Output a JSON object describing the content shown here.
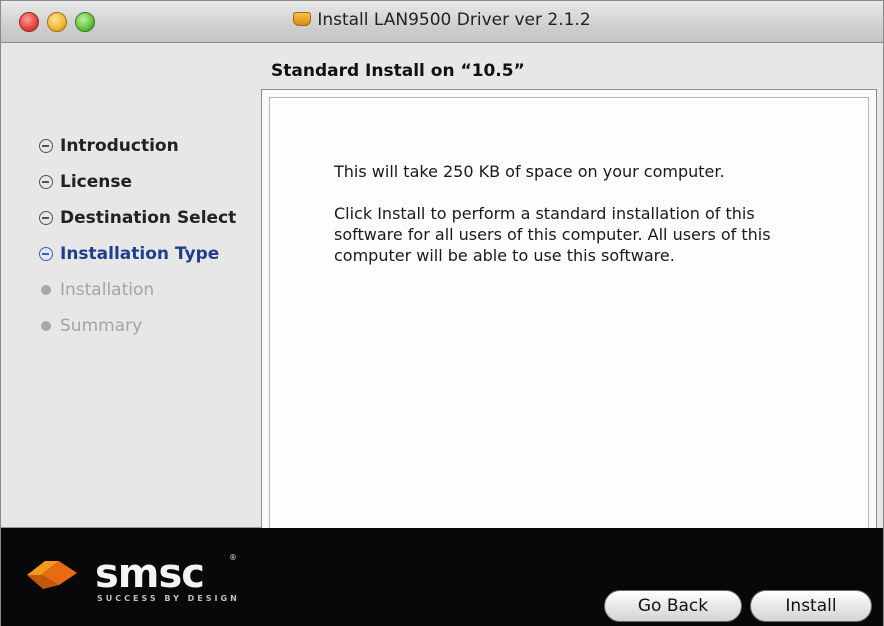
{
  "window": {
    "title": "Install LAN9500 Driver ver 2.1.2"
  },
  "heading": "Standard Install on “10.5”",
  "steps": [
    {
      "label": "Introduction",
      "state": "done"
    },
    {
      "label": "License",
      "state": "done"
    },
    {
      "label": "Destination Select",
      "state": "done"
    },
    {
      "label": "Installation Type",
      "state": "current"
    },
    {
      "label": "Installation",
      "state": "future"
    },
    {
      "label": "Summary",
      "state": "future"
    }
  ],
  "content": {
    "paragraph1": "This will take 250 KB of space on your computer.",
    "paragraph2": "Click Install to perform a standard installation of this software for all users of this computer. All users of this computer will be able to use this software."
  },
  "logo": {
    "name": "smsc",
    "tagline": "SUCCESS BY DESIGN",
    "registered": "®"
  },
  "buttons": {
    "back": "Go Back",
    "install": "Install"
  },
  "colors": {
    "current_step": "#1f3f8a",
    "future_step": "#a4a4a4",
    "bottom_bar": "#080808"
  }
}
